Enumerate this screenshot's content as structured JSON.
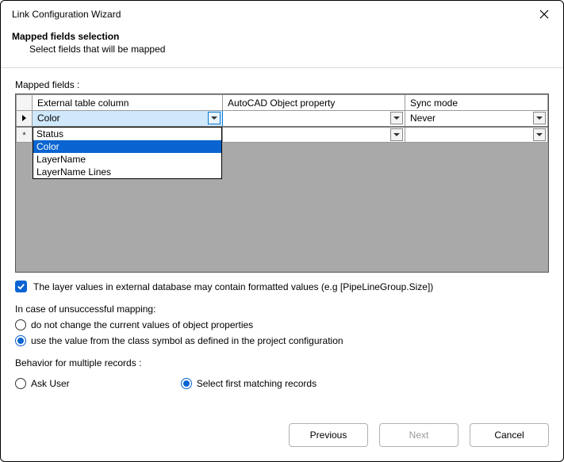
{
  "window": {
    "title": "Link Configuration Wizard"
  },
  "header": {
    "title": "Mapped fields selection",
    "subtitle": "Select fields that will be mapped"
  },
  "mapped_label": "Mapped fields :",
  "grid": {
    "columns": {
      "ext": "External table column",
      "prop": "AutoCAD Object property",
      "sync": "Sync mode"
    },
    "rows": [
      {
        "ext": "Color",
        "prop": "",
        "sync": "Never"
      },
      {
        "ext": "",
        "prop": "",
        "sync": ""
      }
    ],
    "dropdown_options": [
      "Status",
      "Color",
      "LayerName",
      "LayerName Lines"
    ]
  },
  "formatted_values_label": "The layer values in external database may contain formatted values (e.g [PipeLineGroup.Size])",
  "unsuccessful_label": "In case of unsuccessful mapping:",
  "unsuccessful_options": {
    "opt1": "do not change the current values of object properties",
    "opt2": "use the value from the class symbol as defined in the project configuration"
  },
  "behavior_label": "Behavior for multiple records :",
  "behavior_options": {
    "opt1": "Ask User",
    "opt2": "Select first matching records"
  },
  "footer": {
    "previous": "Previous",
    "next": "Next",
    "cancel": "Cancel"
  }
}
